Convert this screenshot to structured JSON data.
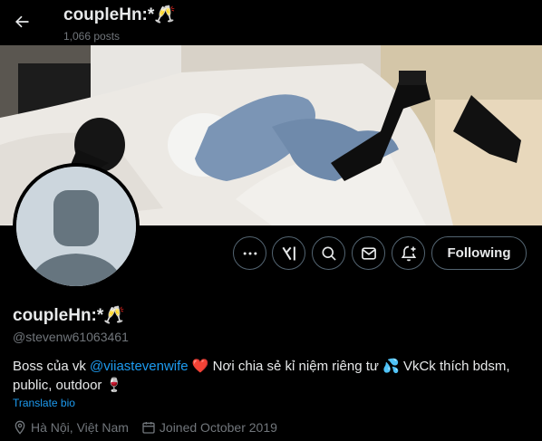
{
  "header": {
    "title": "coupleHn:*🥂",
    "posts_count": "1,066 posts"
  },
  "profile": {
    "display_name": "coupleHn:*🥂",
    "handle": "@stevenw61063461",
    "bio": {
      "text_before": "Boss của vk ",
      "mention": "@viiastevenwife",
      "heart": "❤️",
      "text_after": " Nơi chia sẻ kỉ niệm riêng tư 💦 VkCk thích bdsm, public, outdoor 🍷"
    },
    "translate_label": "Translate bio",
    "location": "Hà Nội, Việt Nam",
    "joined": "Joined October 2019"
  },
  "actions": {
    "following_label": "Following",
    "icons": [
      "more-icon",
      "grok-icon",
      "search-icon",
      "message-icon",
      "notification-add-icon"
    ]
  },
  "colors": {
    "background": "#000000",
    "text": "#e7e9ea",
    "secondary": "#71767b",
    "accent": "#1d9bf0",
    "border": "#536471"
  }
}
